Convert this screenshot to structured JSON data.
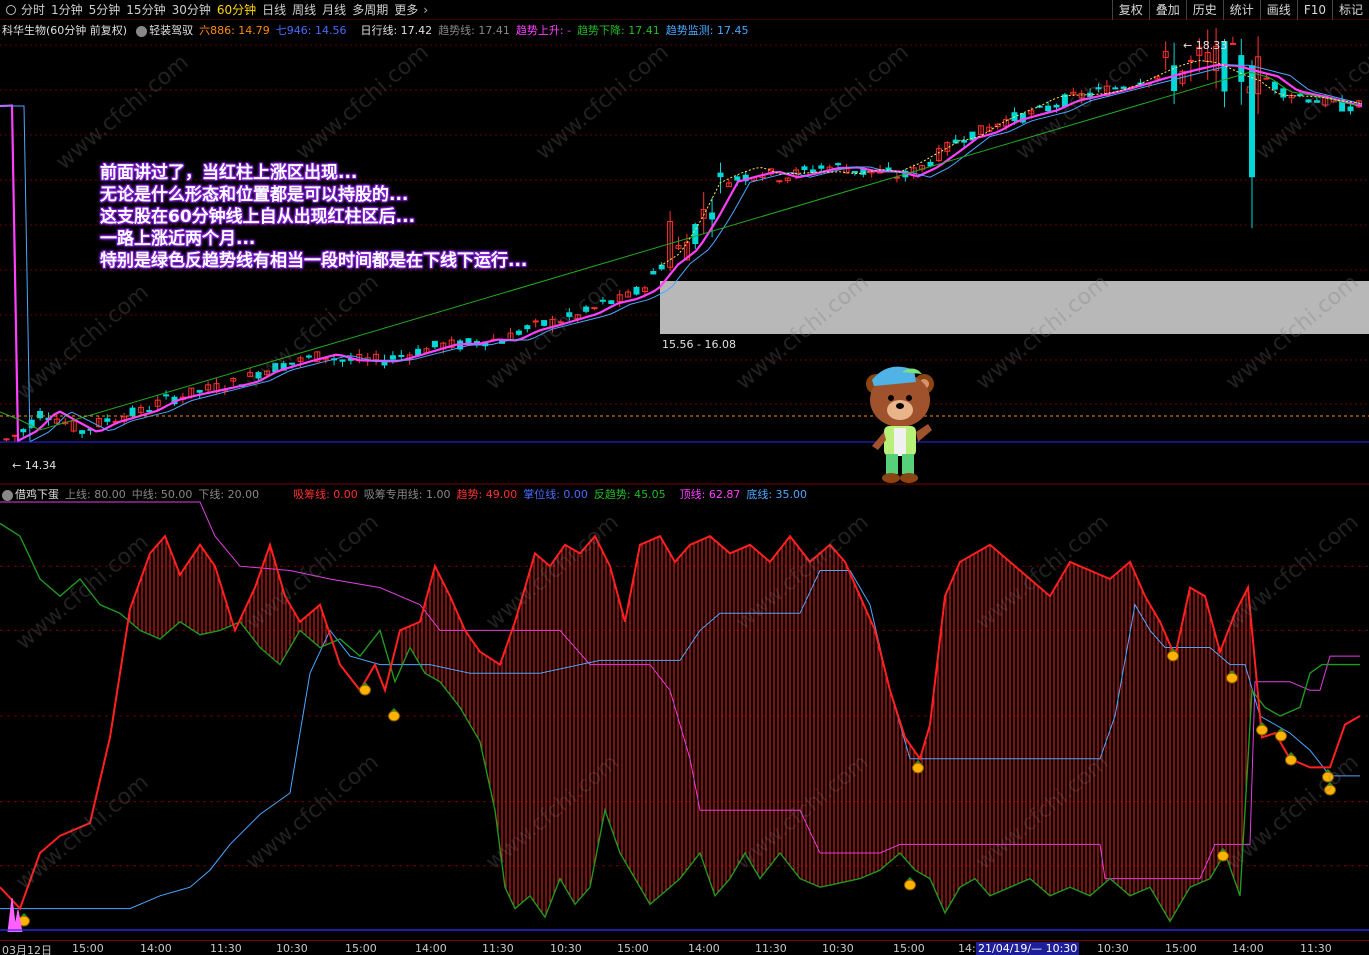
{
  "toolbar": {
    "tabs": [
      "分时",
      "1分钟",
      "5分钟",
      "15分钟",
      "30分钟",
      "60分钟",
      "日线",
      "周线",
      "月线",
      "多周期",
      "更多"
    ],
    "active_tab": "60分钟",
    "right_buttons": [
      "复权",
      "叠加",
      "历史",
      "统计",
      "画线",
      "F10",
      "标记"
    ]
  },
  "main_info": {
    "title": "科华生物(60分钟 前复权)",
    "indicator": "轻装驾驭",
    "ma6": "六886: 14.79",
    "ma7": "七946: 14.56",
    "daily_line": "日行线: 17.42",
    "trend_line": "趋势线: 17.41",
    "trend_up": "趋势上升: -",
    "trend_down": "趋势下降: 17.41",
    "trend_monitor": "趋势监测: 17.45"
  },
  "annotation": [
    "前面讲过了，当红柱上涨区出现...",
    "无论是什么形态和位置都是可以持股的...",
    "这支股在60分钟线上自从出现红柱区后...",
    "一路上涨近两个月...",
    "特别是绿色反趋势线有相当一段时间都是在下线下运行..."
  ],
  "price_labels": {
    "high": "18.33",
    "range": "15.56 - 16.08",
    "low": "14.34"
  },
  "sub_info": {
    "name": "借鸡下蛋",
    "upper": "上线: 80.00",
    "middle": "中线: 50.00",
    "lower": "下线: 20.00",
    "absorb": "吸筹线: 0.00",
    "absorb_special": "吸筹专用线: 1.00",
    "trend": "趋势: 49.00",
    "hold": "掌位线: 0.00",
    "anti_trend": "反趋势: 45.05",
    "top": "顶线: 62.87",
    "bottom": "底线: 35.00"
  },
  "time_axis": [
    "03月12日",
    "15:00",
    "14:00",
    "11:30",
    "10:30",
    "15:00",
    "14:00",
    "11:30",
    "10:30",
    "15:00",
    "14:00",
    "11:30",
    "10:30",
    "15:00",
    "14:",
    "21/04/19/— 10:30",
    "10:30",
    "15:00",
    "14:00",
    "11:30"
  ],
  "watermark": "www.cfchi.com",
  "colors": {
    "up": "#ff3030",
    "down": "#00e5e5",
    "trend_magenta": "#ff40ff",
    "blue_line": "#4aa8ff",
    "green_line": "#22aa22",
    "grid": "#7a0000",
    "highlight": "#1e1e9a"
  },
  "chart_data": {
    "type": "candlestick",
    "price_series_points": [
      [
        0,
        14.5
      ],
      [
        20,
        14.6
      ],
      [
        40,
        14.8
      ],
      [
        60,
        14.7
      ],
      [
        80,
        14.6
      ],
      [
        100,
        14.7
      ],
      [
        120,
        14.75
      ],
      [
        140,
        14.8
      ],
      [
        160,
        14.9
      ],
      [
        180,
        14.95
      ],
      [
        200,
        15.0
      ],
      [
        220,
        15.05
      ],
      [
        240,
        15.1
      ],
      [
        260,
        15.2
      ],
      [
        280,
        15.25
      ],
      [
        300,
        15.3
      ],
      [
        320,
        15.35
      ],
      [
        340,
        15.3
      ],
      [
        360,
        15.3
      ],
      [
        380,
        15.3
      ],
      [
        400,
        15.35
      ],
      [
        420,
        15.4
      ],
      [
        440,
        15.45
      ],
      [
        460,
        15.45
      ],
      [
        480,
        15.5
      ],
      [
        500,
        15.5
      ],
      [
        520,
        15.6
      ],
      [
        540,
        15.65
      ],
      [
        560,
        15.7
      ],
      [
        580,
        15.75
      ],
      [
        600,
        15.85
      ],
      [
        620,
        15.9
      ],
      [
        640,
        16.0
      ],
      [
        660,
        16.25
      ],
      [
        680,
        16.4
      ],
      [
        700,
        16.7
      ],
      [
        720,
        17.05
      ],
      [
        740,
        17.1
      ],
      [
        760,
        17.15
      ],
      [
        780,
        17.1
      ],
      [
        800,
        17.15
      ],
      [
        820,
        17.2
      ],
      [
        840,
        17.2
      ],
      [
        860,
        17.15
      ],
      [
        880,
        17.15
      ],
      [
        900,
        17.1
      ],
      [
        920,
        17.2
      ],
      [
        940,
        17.35
      ],
      [
        960,
        17.5
      ],
      [
        980,
        17.55
      ],
      [
        1000,
        17.65
      ],
      [
        1020,
        17.7
      ],
      [
        1040,
        17.75
      ],
      [
        1060,
        17.85
      ],
      [
        1080,
        17.9
      ],
      [
        1100,
        17.95
      ],
      [
        1120,
        18.0
      ],
      [
        1140,
        18.05
      ],
      [
        1160,
        18.1
      ],
      [
        1180,
        18.15
      ],
      [
        1200,
        18.2
      ],
      [
        1220,
        18.2
      ],
      [
        1240,
        18.15
      ],
      [
        1260,
        18.1
      ],
      [
        1280,
        17.95
      ],
      [
        1300,
        17.9
      ],
      [
        1320,
        17.85
      ],
      [
        1340,
        17.8
      ],
      [
        1360,
        17.8
      ]
    ],
    "sub_indicator_ylim": [
      0,
      100
    ],
    "sub_levels": {
      "upper": 80,
      "middle": 50,
      "lower": 20
    }
  }
}
